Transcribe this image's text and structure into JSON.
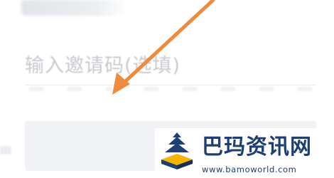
{
  "form": {
    "invite_code_placeholder": "输入邀请码(选填)"
  },
  "colors": {
    "arrow": "#f08a3c",
    "placeholder": "#c8cacf",
    "field_background": "#f1f2f5",
    "watermark_text": "#1e3f73",
    "watermark_logo_accent": "#f4b400"
  },
  "watermark": {
    "name": "巴玛资讯网",
    "url": "www.bamoworld.com"
  }
}
